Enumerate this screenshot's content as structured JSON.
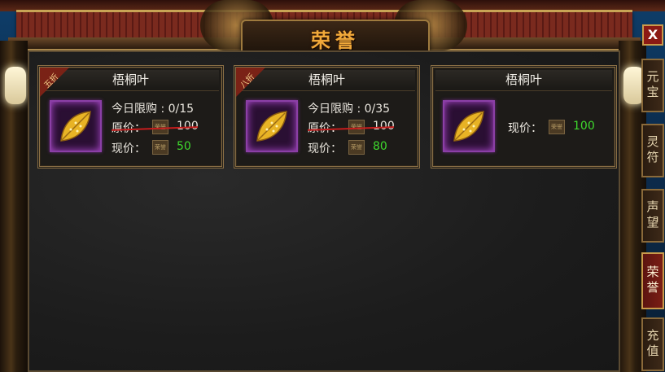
{
  "window": {
    "title": "荣誉",
    "close_label": "X"
  },
  "tabs": [
    {
      "label": "元宝",
      "active": false
    },
    {
      "label": "灵符",
      "active": false
    },
    {
      "label": "声望",
      "active": false
    },
    {
      "label": "荣誉",
      "active": true
    },
    {
      "label": "充值",
      "active": false
    }
  ],
  "items": [
    {
      "name": "梧桐叶",
      "badge": "五折",
      "limit_label": "今日限购",
      "limit_value": "0/15",
      "original_label": "原价：",
      "original_price": "100",
      "current_label": "现价：",
      "current_price": "50",
      "currency_text": "荣誉"
    },
    {
      "name": "梧桐叶",
      "badge": "八折",
      "limit_label": "今日限购",
      "limit_value": "0/35",
      "original_label": "原价：",
      "original_price": "100",
      "current_label": "现价：",
      "current_price": "80",
      "currency_text": "荣誉"
    },
    {
      "name": "梧桐叶",
      "current_label": "现价：",
      "current_price": "100",
      "currency_text": "荣誉"
    }
  ],
  "colors": {
    "discount_price": "#3ed92d",
    "strike": "#c61d1d",
    "title_gold": "#f1a93a",
    "item_frame": "#8b3fa6"
  },
  "icons": {
    "item": "golden-leaf-icon",
    "currency": "honor-coin-icon"
  }
}
